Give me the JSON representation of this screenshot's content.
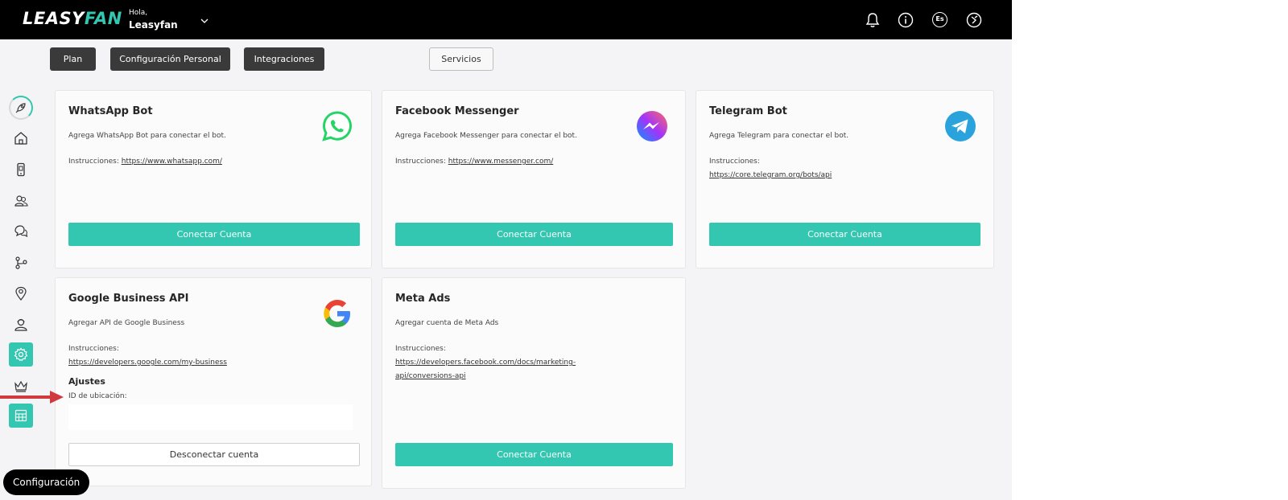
{
  "header": {
    "logo_main": "LEASY",
    "logo_accent": "FAN",
    "greeting": "Hola,",
    "user_name": "Leasyfan",
    "language": "Es"
  },
  "sidebar": {
    "icons": [
      "rocket-icon",
      "home-icon",
      "phone-icon",
      "contacts-icon",
      "chat-icon",
      "flow-icon",
      "location-icon",
      "agent-icon",
      "settings-icon",
      "crown-icon",
      "calculator-icon"
    ],
    "active": "settings-icon"
  },
  "tabs": [
    {
      "label": "Plan"
    },
    {
      "label": "Configuración Personal"
    },
    {
      "label": "Integraciones"
    },
    {
      "label": "Servicios"
    }
  ],
  "cards": {
    "whatsapp": {
      "title": "WhatsApp Bot",
      "description": "Agrega WhatsApp Bot para conectar el bot.",
      "instructions_label": "Instrucciones:",
      "link": "https://www.whatsapp.com/",
      "button": "Conectar Cuenta"
    },
    "messenger": {
      "title": "Facebook Messenger",
      "description": "Agrega Facebook Messenger para conectar el bot.",
      "instructions_label": "Instrucciones:",
      "link": "https://www.messenger.com/",
      "button": "Conectar Cuenta"
    },
    "telegram": {
      "title": "Telegram Bot",
      "description": "Agrega Telegram para conectar el bot.",
      "instructions_label": "Instrucciones:",
      "link": "https://core.telegram.org/bots/api",
      "button": "Conectar Cuenta"
    },
    "google": {
      "title": "Google Business API",
      "description": "Agregar API de Google Business",
      "instructions_label": "Instrucciones:",
      "link": "https://developers.google.com/my-business",
      "settings_title": "Ajustes",
      "location_label": "ID de ubicación:",
      "location_value": "",
      "button": "Desconectar cuenta"
    },
    "meta": {
      "title": "Meta Ads",
      "description": "Agregar cuenta de Meta Ads",
      "instructions_label": "Instrucciones:",
      "link_line1": "https://developers.facebook.com/docs/marketing-",
      "link_line2": "api/conversions-api",
      "button": "Conectar Cuenta"
    }
  },
  "footer_pill": "Configuración",
  "colors": {
    "accent": "#33c6b0",
    "topbar": "#000000",
    "arrow": "#d0393e"
  }
}
